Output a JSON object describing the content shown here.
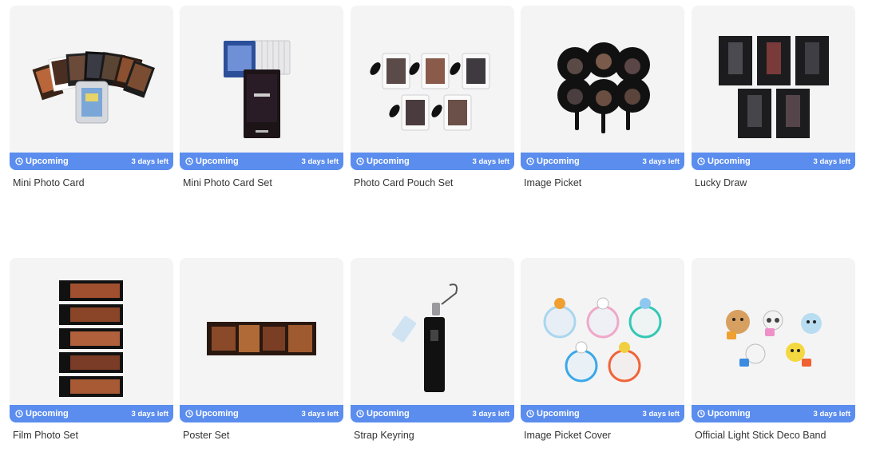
{
  "colors": {
    "status_bar": "#5b8def",
    "card_bg": "#f4f4f5",
    "title_text": "#333333"
  },
  "products": [
    {
      "name": "Mini Photo Card",
      "status": "Upcoming",
      "time_left": "3 days left",
      "thumbnail": "photo-cards-fan-image"
    },
    {
      "name": "Mini Photo Card Set",
      "status": "Upcoming",
      "time_left": "3 days left",
      "thumbnail": "photo-card-set-box-image"
    },
    {
      "name": "Photo Card Pouch Set",
      "status": "Upcoming",
      "time_left": "3 days left",
      "thumbnail": "pouch-set-image"
    },
    {
      "name": "Image Picket",
      "status": "Upcoming",
      "time_left": "3 days left",
      "thumbnail": "hand-fan-pickets-image"
    },
    {
      "name": "Lucky Draw",
      "status": "Upcoming",
      "time_left": "3 days left",
      "thumbnail": "lucky-draw-cards-image"
    },
    {
      "name": "Film Photo Set",
      "status": "Upcoming",
      "time_left": "3 days left",
      "thumbnail": "film-strips-image"
    },
    {
      "name": "Poster Set",
      "status": "Upcoming",
      "time_left": "3 days left",
      "thumbnail": "poster-image"
    },
    {
      "name": "Strap Keyring",
      "status": "Upcoming",
      "time_left": "3 days left",
      "thumbnail": "strap-keyring-image"
    },
    {
      "name": "Image Picket Cover",
      "status": "Upcoming",
      "time_left": "3 days left",
      "thumbnail": "picket-covers-image"
    },
    {
      "name": "Official Light Stick Deco Band",
      "status": "Upcoming",
      "time_left": "3 days left",
      "thumbnail": "character-deco-bands-image"
    }
  ]
}
